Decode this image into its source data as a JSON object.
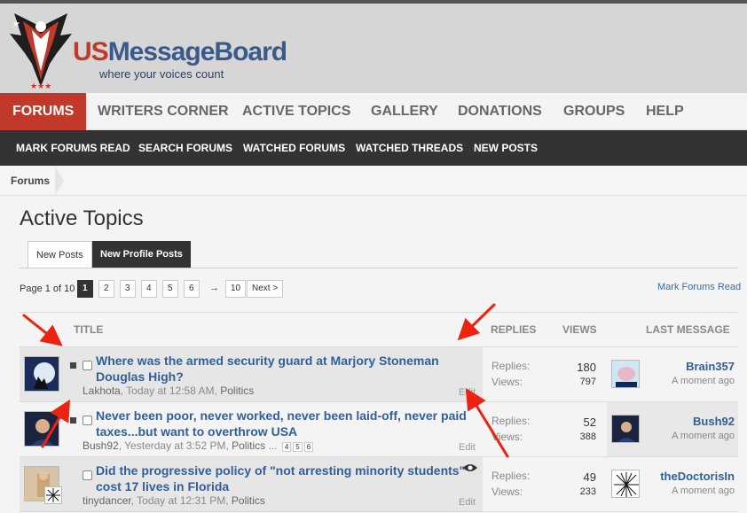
{
  "site": {
    "logo_us": "US",
    "logo_mb": "MessageBoard",
    "tagline": "where your voices count"
  },
  "main_nav": {
    "items": [
      {
        "label": "FORUMS"
      },
      {
        "label": "WRITERS CORNER"
      },
      {
        "label": "ACTIVE TOPICS"
      },
      {
        "label": "GALLERY"
      },
      {
        "label": "DONATIONS"
      },
      {
        "label": "GROUPS"
      },
      {
        "label": "HELP"
      }
    ]
  },
  "sub_nav": {
    "items": [
      {
        "label": "MARK FORUMS READ"
      },
      {
        "label": "SEARCH FORUMS"
      },
      {
        "label": "WATCHED FORUMS"
      },
      {
        "label": "WATCHED THREADS"
      },
      {
        "label": "NEW POSTS"
      }
    ]
  },
  "breadcrumb": {
    "label": "Forums"
  },
  "page": {
    "title": "Active Topics",
    "tabs": [
      {
        "label": "New Posts"
      },
      {
        "label": "New Profile Posts"
      }
    ],
    "pager": {
      "label": "Page 1 of 10",
      "pages": [
        "1",
        "2",
        "3",
        "4",
        "5",
        "6"
      ],
      "arrow": "→",
      "last": "10",
      "next": "Next >"
    },
    "mark_read": "Mark Forums Read"
  },
  "table": {
    "headers": {
      "title": "TITLE",
      "replies": "REPLIES",
      "views": "VIEWS",
      "last_message": "LAST MESSAGE"
    },
    "stat_labels": {
      "replies": "Replies:",
      "views": "Views:"
    },
    "edit_label": "Edit",
    "rows": [
      {
        "title": "Where was the armed security guard at Marjory Stoneman Douglas High?",
        "author": "Lakhota",
        "time": "Today at 12:58 AM",
        "forum": "Politics",
        "replies": "180",
        "views": "797",
        "last_user": "Brain357",
        "last_time": "A moment ago"
      },
      {
        "title": "Never been poor, never worked, never been laid-off, never paid taxes...but want to overthrow USA",
        "author": "Bush92",
        "time": "Yesterday at 3:52 PM",
        "forum": "Politics",
        "ellipsis": "...",
        "mini_pages": [
          "4",
          "5",
          "6"
        ],
        "replies": "52",
        "views": "388",
        "last_user": "Bush92",
        "last_time": "A moment ago"
      },
      {
        "title": "Did the progressive policy of \"not arresting minority students\" cost 17 lives in Florida",
        "author": "tinydancer",
        "time": "Today at 12:31 PM",
        "forum": "Politics",
        "replies": "49",
        "views": "233",
        "last_user": "theDoctorisIn",
        "last_time": "A moment ago"
      }
    ]
  },
  "meta_sep": ", ",
  "colors": {
    "accent_red": "#c1392b",
    "link_blue": "#2f5f9c",
    "annotation_red": "#ee2211"
  }
}
